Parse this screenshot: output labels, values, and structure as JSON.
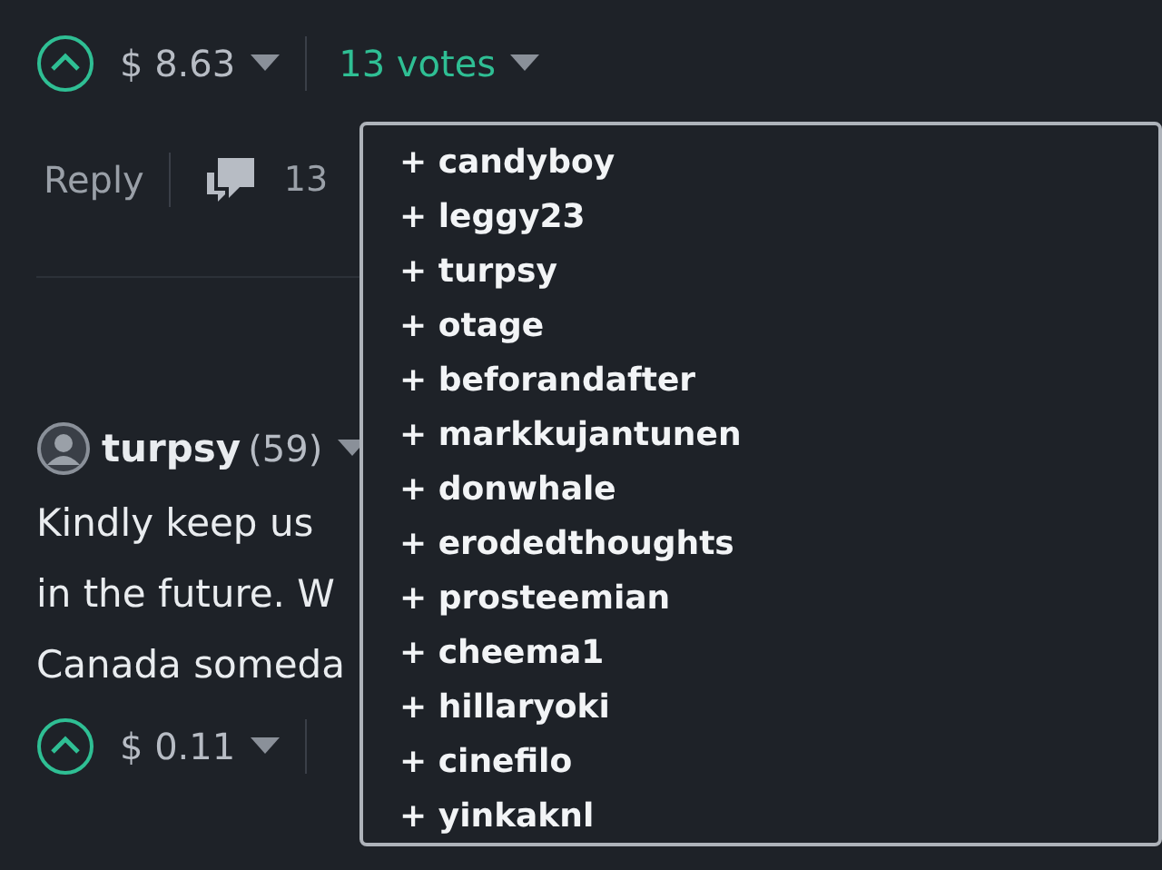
{
  "post_footer": {
    "payout": "$ 8.63",
    "votes": "13 votes",
    "reply": "Reply",
    "comment_count": "13"
  },
  "comment": {
    "author": "turpsy",
    "reputation": "(59)",
    "body_lines": [
      "Kindly keep us",
      "in the future. W",
      "Canada someda"
    ],
    "payout": "$ 0.11"
  },
  "voters_popup": {
    "items": [
      "+ candyboy",
      "+ leggy23",
      "+ turpsy",
      "+ otage",
      "+ beforandafter",
      "+ markkujantunen",
      "+ donwhale",
      "+ erodedthoughts",
      "+ prosteemian",
      "+ cheema1",
      "+ hillaryoki",
      "+ cinefilo",
      "+ yinkaknl"
    ]
  }
}
